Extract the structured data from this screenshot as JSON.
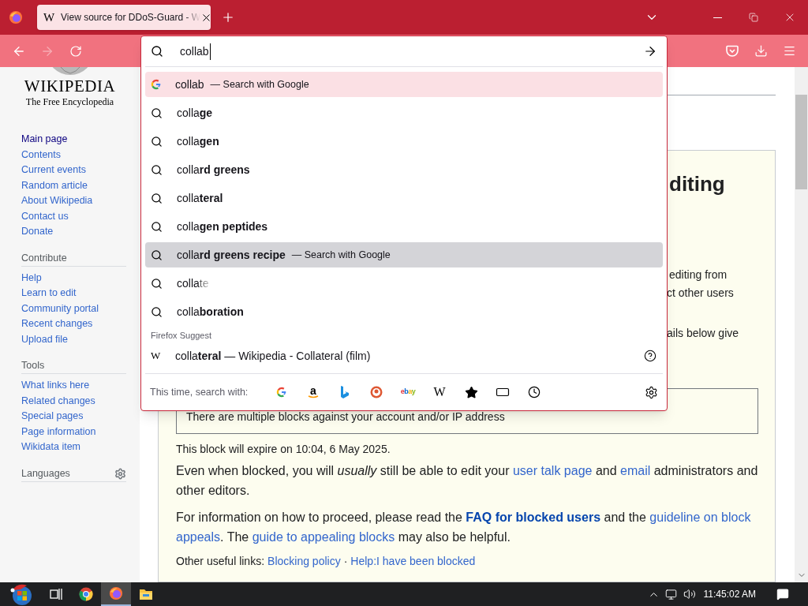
{
  "tab": {
    "favicon": "W",
    "title": "View source for DDoS-Guard - W",
    "selected": true
  },
  "nav": {
    "back": {
      "disabled": false
    },
    "forward": {
      "disabled": true
    }
  },
  "address_bar": {
    "value": "collab"
  },
  "suggestions": [
    {
      "kind": "engine",
      "text": "collab",
      "note": "— Search with Google",
      "selected": true,
      "hovered": false
    },
    {
      "kind": "suggestion",
      "text": "colla",
      "bold": "ge",
      "selected": false,
      "hovered": false
    },
    {
      "kind": "suggestion",
      "text": "colla",
      "bold": "gen",
      "selected": false,
      "hovered": false
    },
    {
      "kind": "suggestion",
      "text": "colla",
      "bold": "rd greens",
      "selected": false,
      "hovered": false
    },
    {
      "kind": "suggestion",
      "text": "colla",
      "bold": "teral",
      "selected": false,
      "hovered": false
    },
    {
      "kind": "suggestion",
      "text": "colla",
      "bold": "gen peptides",
      "selected": false,
      "hovered": false
    },
    {
      "kind": "suggestion",
      "text": "colla",
      "bold": "rd greens recipe",
      "note": "— Search with Google",
      "selected": false,
      "hovered": true
    },
    {
      "kind": "suggestion",
      "text": "colla",
      "fading": "te",
      "selected": false,
      "hovered": false
    },
    {
      "kind": "suggestion",
      "text": "colla",
      "bold": "boration",
      "selected": false,
      "hovered": false
    }
  ],
  "firefox_suggest": {
    "heading": "Firefox Suggest",
    "item": {
      "icon": "W",
      "text": "colla",
      "bold": "teral",
      "rest": " — Wikipedia - Collateral (film)"
    }
  },
  "search_with": {
    "label": "This time, search with:",
    "engines": [
      {
        "kind": "google"
      },
      {
        "kind": "amazon",
        "glyph": "a"
      },
      {
        "kind": "bing"
      },
      {
        "kind": "duckduckgo"
      },
      {
        "kind": "ebay",
        "glyph": "ebay"
      },
      {
        "kind": "wikipedia",
        "glyph": "W"
      },
      {
        "kind": "bookmarks"
      },
      {
        "kind": "tabs"
      },
      {
        "kind": "history"
      }
    ]
  },
  "sidebar": {
    "logo": {
      "wordmark": "WIKIPEDIA",
      "tagline": "The Free Encyclopedia"
    },
    "sections": [
      {
        "links": [
          {
            "label": "Main page",
            "visited": true
          },
          {
            "label": "Contents",
            "visited": false
          },
          {
            "label": "Current events",
            "visited": false
          },
          {
            "label": "Random article",
            "visited": false
          },
          {
            "label": "About Wikipedia",
            "visited": false
          },
          {
            "label": "Contact us",
            "visited": false
          },
          {
            "label": "Donate",
            "visited": false
          }
        ]
      },
      {
        "heading": "Contribute",
        "links": [
          {
            "label": "Help",
            "visited": false
          },
          {
            "label": "Learn to edit",
            "visited": false
          },
          {
            "label": "Community portal",
            "visited": false
          },
          {
            "label": "Recent changes",
            "visited": false
          },
          {
            "label": "Upload file",
            "visited": false
          }
        ]
      },
      {
        "heading": "Tools",
        "links": [
          {
            "label": "What links here",
            "visited": false
          },
          {
            "label": "Related changes",
            "visited": false
          },
          {
            "label": "Special pages",
            "visited": false
          },
          {
            "label": "Page information",
            "visited": false
          },
          {
            "label": "Wikidata item",
            "visited": false
          }
        ]
      },
      {
        "heading": "Languages",
        "settings": true
      }
    ]
  },
  "page": {
    "heading_fragment": "diting",
    "fragments": [
      "editing from",
      "ct other users",
      "ails below give"
    ],
    "notice": "There are multiple blocks against your account and/or IP address",
    "expiry": "This block will expire on 10:04, 6 May 2025.",
    "paragraphs": [
      [
        {
          "kind": "text",
          "text": "Even when blocked, you will *usually* still be able to edit your "
        },
        {
          "kind": "link",
          "text": "user talk page",
          "bold": false
        },
        {
          "kind": "text",
          "text": " and "
        },
        {
          "kind": "link",
          "text": "email",
          "bold": false
        },
        {
          "kind": "text",
          "text": " administrators and other editors."
        }
      ],
      [
        {
          "kind": "text",
          "text": "For information on how to proceed, please read the "
        },
        {
          "kind": "link",
          "text": "FAQ for blocked users",
          "bold": true
        },
        {
          "kind": "text",
          "text": " and the "
        },
        {
          "kind": "link",
          "text": "guideline on block",
          "bold": false
        },
        {
          "kind": "link",
          "text": "appeals",
          "bold": false
        },
        {
          "kind": "text",
          "text": ". The "
        },
        {
          "kind": "link",
          "text": "guide to appealing blocks",
          "bold": false
        },
        {
          "kind": "text",
          "text": " may also be helpful."
        }
      ]
    ],
    "other_links": {
      "label": "Other useful links:",
      "links": [
        "Blocking policy",
        "Help:I have been blocked"
      ],
      "separator": "·"
    }
  },
  "taskbar": {
    "apps": [
      {
        "kind": "start",
        "active": false
      },
      {
        "kind": "taskview",
        "active": false
      },
      {
        "kind": "chrome",
        "active": false
      },
      {
        "kind": "firefox",
        "active": true
      },
      {
        "kind": "explorer",
        "active": false
      }
    ],
    "clock": "11:45:02 AM"
  }
}
